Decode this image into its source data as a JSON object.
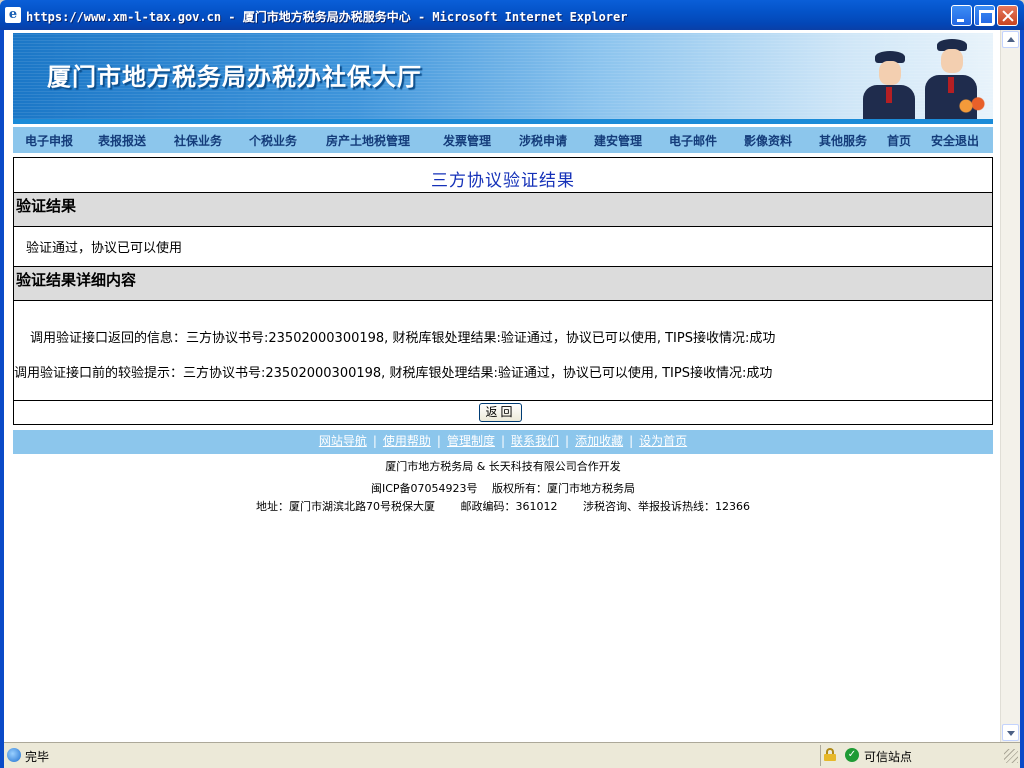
{
  "window": {
    "icon": "ie-page-icon",
    "title": "https://www.xm-l-tax.gov.cn - 厦门市地方税务局办税服务中心 - Microsoft Internet Explorer"
  },
  "banner": {
    "site_title": "厦门市地方税务局办税办社保大厅"
  },
  "nav": {
    "items": [
      {
        "label": "电子申报"
      },
      {
        "label": "表报报送"
      },
      {
        "label": "社保业务"
      },
      {
        "label": "个税业务"
      },
      {
        "label": "房产土地税管理"
      },
      {
        "label": "发票管理"
      },
      {
        "label": "涉税申请"
      },
      {
        "label": "建安管理"
      },
      {
        "label": "电子邮件"
      },
      {
        "label": "影像资料"
      },
      {
        "label": "其他服务"
      },
      {
        "label": "首页"
      },
      {
        "label": "安全退出"
      }
    ]
  },
  "main": {
    "page_title": "三方协议验证结果",
    "section1": {
      "heading": "验证结果",
      "text": "验证通过，协议已可以使用"
    },
    "section2": {
      "heading": "验证结果详细内容",
      "line1": "调用验证接口返回的信息：三方协议书号:23502000300198, 财税库银处理结果:验证通过，协议已可以使用, TIPS接收情况:成功",
      "line2": "调用验证接口前的较验提示：三方协议书号:23502000300198, 财税库银处理结果:验证通过，协议已可以使用, TIPS接收情况:成功"
    },
    "back_button": "返回"
  },
  "footer": {
    "links": [
      "网站导航",
      "使用帮助",
      "管理制度",
      "联系我们",
      "添加收藏",
      "设为首页"
    ],
    "line1": "厦门市地方税务局 & 长天科技有限公司合作开发",
    "line2": "闽ICP备07054923号　 版权所有：厦门市地方税务局",
    "line3": "地址：厦门市湖滨北路70号税保大厦　　 邮政编码：361012　　 涉税咨询、举报投诉热线：12366"
  },
  "statusbar": {
    "status_text": "完毕",
    "zone_text": "可信站点"
  },
  "colors": {
    "titlebar": "#0453c8",
    "nav_bg": "#8cc6ec",
    "nav_text": "#143c7a",
    "page_title": "#1531b8",
    "section_bg": "#dcdcdc"
  }
}
